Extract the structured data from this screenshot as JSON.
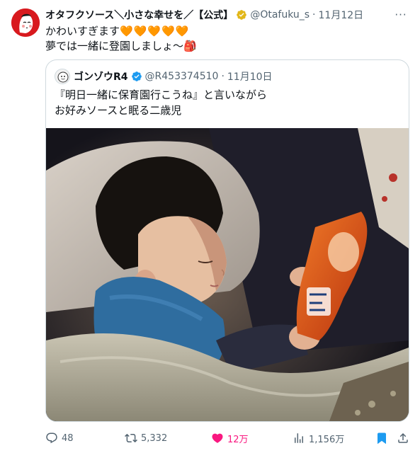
{
  "tweet": {
    "author_name": "オタフクソース＼小さな幸せを／【公式】",
    "handle": "@Otafuku_s",
    "separator": "·",
    "date": "11月12日",
    "text_line1": "かわいすぎます",
    "hearts": "🧡🧡🧡🧡🧡",
    "text_line2": "夢では一緒に登園しましょ〜",
    "bag_emoji": "🎒",
    "more_label": "···"
  },
  "quote": {
    "author_name": "ゴンゾウR4",
    "handle": "@R453374510",
    "separator": "·",
    "date": "11月10日",
    "text_line1": "『明日一緒に保育園行こうね』と言いながら",
    "text_line2": "お好みソースと眠る二歳児"
  },
  "actions": {
    "replies": "48",
    "retweets": "5,332",
    "likes": "12万",
    "views": "1,156万"
  },
  "colors": {
    "accent_like": "#f91880",
    "verified_gold": "#e2b719",
    "verified_blue": "#1d9bf0",
    "bookmark_blue": "#1d9bf0",
    "brand_red": "#d8191e"
  }
}
